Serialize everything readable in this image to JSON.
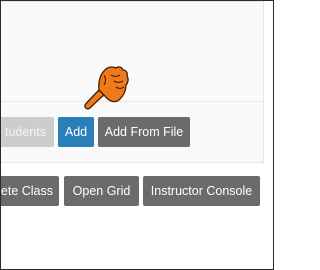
{
  "toolbar": {
    "students_label": "tudents",
    "add_label": "Add",
    "add_from_file_label": "Add From File"
  },
  "actions": {
    "delete_class_label": "ete Class",
    "open_grid_label": "Open Grid",
    "instructor_console_label": "Instructor Console"
  },
  "cursor": {
    "icon": "hand-pointer-icon",
    "color": "#f07a1a"
  },
  "colors": {
    "primary": "#2b7fb8",
    "secondary": "#6b6b6b",
    "disabled": "#cdcdcd"
  }
}
